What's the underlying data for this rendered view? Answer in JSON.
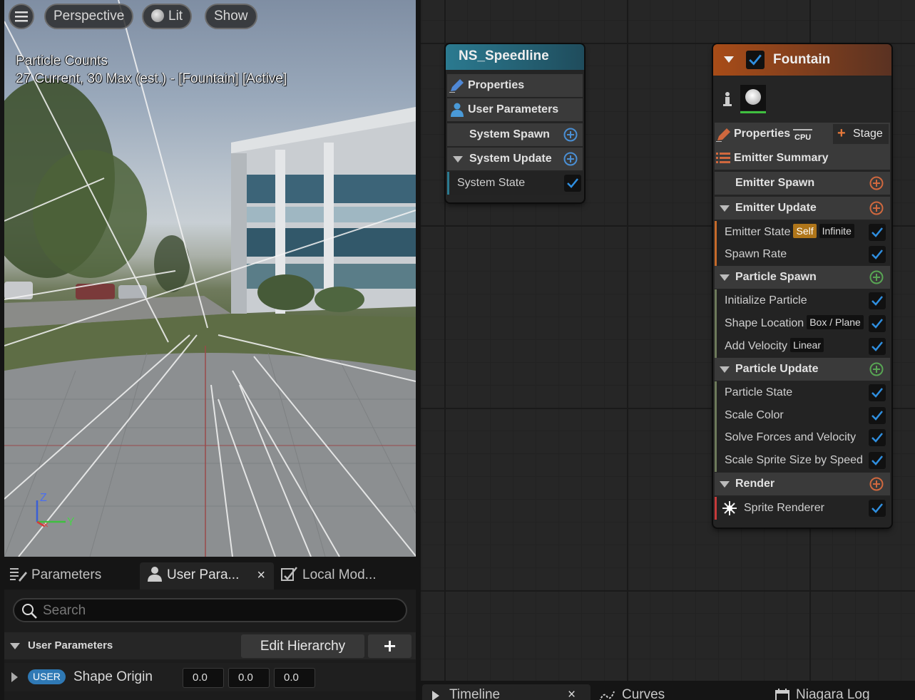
{
  "viewport": {
    "menu_icon": "hamburger-icon",
    "perspective_label": "Perspective",
    "lit_label": "Lit",
    "show_label": "Show",
    "stats_title": "Particle Counts",
    "stats_line": "27 Current, 30 Max (est.) - [Fountain] [Active]",
    "axis_z": "Z",
    "axis_y": "Y"
  },
  "bottom_left": {
    "tabs": [
      {
        "label": "Parameters",
        "icon": "parameters-icon"
      },
      {
        "label": "User Para...",
        "icon": "user-icon",
        "close": "×"
      },
      {
        "label": "Local Mod...",
        "icon": "local-modules-icon"
      }
    ],
    "search_placeholder": "Search",
    "section_label": "User Parameters",
    "edit_hierarchy_label": "Edit Hierarchy",
    "add_label": "+",
    "param": {
      "badge": "USER",
      "name": "Shape Origin",
      "x": "0.0",
      "y": "0.0",
      "z": "0.0"
    }
  },
  "system_node": {
    "title": "NS_Speedline",
    "header_color": "#2a6f85",
    "rows": {
      "properties": "Properties",
      "user_parameters": "User Parameters",
      "system_spawn": "System Spawn",
      "system_update": "System Update",
      "system_state": "System State"
    }
  },
  "emitter_node": {
    "title": "Fountain",
    "header_color": "#b0521c",
    "properties": "Properties",
    "cpu_label": "CPU",
    "stage_label": "Stage",
    "emitter_summary": "Emitter Summary",
    "emitter_spawn": "Emitter Spawn",
    "emitter_update": "Emitter Update",
    "emitter_state": "Emitter State",
    "self_tag": "Self",
    "infinite_tag": "Infinite",
    "spawn_rate": "Spawn Rate",
    "particle_spawn": "Particle Spawn",
    "initialize_particle": "Initialize Particle",
    "shape_location": "Shape Location",
    "box_plane_tag": "Box / Plane",
    "add_velocity": "Add Velocity",
    "linear_tag": "Linear",
    "particle_update": "Particle Update",
    "particle_state": "Particle State",
    "scale_color": "Scale Color",
    "solve_forces": "Solve Forces and Velocity",
    "scale_sprite": "Scale Sprite Size by Speed",
    "render": "Render",
    "sprite_renderer": "Sprite Renderer"
  },
  "bottom_right": {
    "tabs": [
      {
        "label": "Timeline",
        "close": "×"
      },
      {
        "label": "Curves"
      },
      {
        "label": "Niagara Log"
      }
    ]
  },
  "colors": {
    "accent_blue": "#2f7fd0",
    "add_orange": "#d0683e",
    "add_green": "#58a553",
    "add_blue": "#4a8fd4"
  }
}
